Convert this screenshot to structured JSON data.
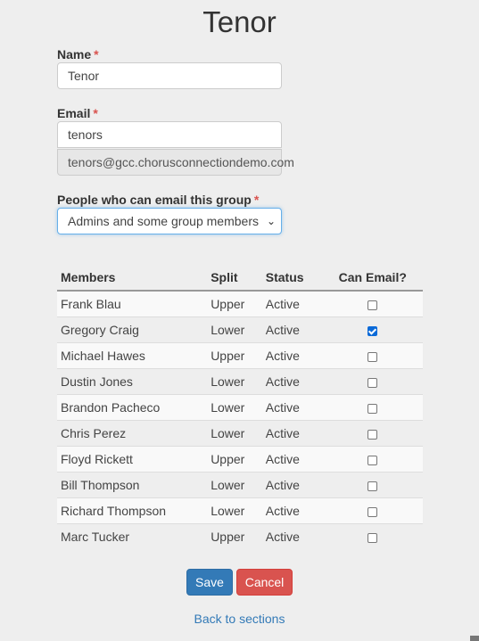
{
  "page": {
    "title": "Tenor"
  },
  "form": {
    "name": {
      "label": "Name",
      "required_mark": "*",
      "value": "Tenor"
    },
    "email": {
      "label": "Email",
      "required_mark": "*",
      "value": "tenors",
      "full_address": "tenors@gcc.chorusconnectiondemo.com"
    },
    "permission": {
      "label": "People who can email this group",
      "required_mark": "*",
      "selected": "Admins and some group members",
      "icon": "chevron-down-icon"
    }
  },
  "members_table": {
    "headers": [
      "Members",
      "Split",
      "Status",
      "Can Email?"
    ],
    "rows": [
      {
        "name": "Frank Blau",
        "split": "Upper",
        "status": "Active",
        "can_email": false
      },
      {
        "name": "Gregory Craig",
        "split": "Lower",
        "status": "Active",
        "can_email": true
      },
      {
        "name": "Michael Hawes",
        "split": "Upper",
        "status": "Active",
        "can_email": false
      },
      {
        "name": "Dustin Jones",
        "split": "Lower",
        "status": "Active",
        "can_email": false
      },
      {
        "name": "Brandon Pacheco",
        "split": "Lower",
        "status": "Active",
        "can_email": false
      },
      {
        "name": "Chris Perez",
        "split": "Lower",
        "status": "Active",
        "can_email": false
      },
      {
        "name": "Floyd Rickett",
        "split": "Upper",
        "status": "Active",
        "can_email": false
      },
      {
        "name": "Bill Thompson",
        "split": "Lower",
        "status": "Active",
        "can_email": false
      },
      {
        "name": "Richard Thompson",
        "split": "Lower",
        "status": "Active",
        "can_email": false
      },
      {
        "name": "Marc Tucker",
        "split": "Upper",
        "status": "Active",
        "can_email": false
      }
    ]
  },
  "actions": {
    "save_label": "Save",
    "cancel_label": "Cancel",
    "back_link": "Back to sections"
  },
  "colors": {
    "primary": "#337ab7",
    "danger": "#d9534f",
    "checkbox_checked": "#0b6ad8"
  }
}
